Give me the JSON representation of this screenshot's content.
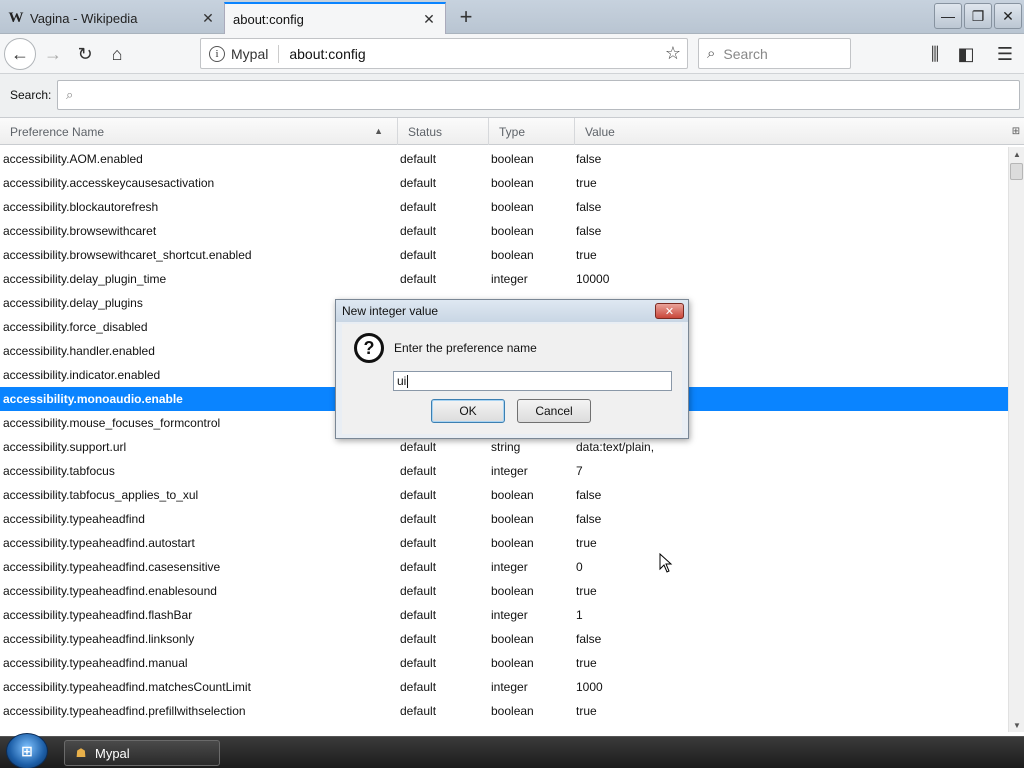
{
  "tabs": [
    {
      "favicon": "W",
      "title": "Vagina - Wikipedia",
      "close": "✕"
    },
    {
      "title": "about:config",
      "close": "✕"
    }
  ],
  "newtab_symbol": "+",
  "window_controls": {
    "minimize": "—",
    "restore": "❐",
    "close": "✕"
  },
  "navbar": {
    "back_symbol": "←",
    "forward_symbol": "→",
    "reload_symbol": "↻",
    "home_symbol": "⌂",
    "identity_label": "Mypal",
    "url": "about:config",
    "bookmark_symbol": "☆",
    "search_placeholder": "Search",
    "library_symbol": "⫼",
    "sidebar_symbol": "◧",
    "menu_symbol": "☰"
  },
  "config_search": {
    "label": "Search:",
    "placeholder": "⌕"
  },
  "columns": {
    "name": "Preference Name",
    "status": "Status",
    "type": "Type",
    "value": "Value",
    "sort_symbol": "▲",
    "picker_symbol": "⊞"
  },
  "rows": [
    {
      "name": "accessibility.AOM.enabled",
      "status": "default",
      "type": "boolean",
      "value": "false"
    },
    {
      "name": "accessibility.accesskeycausesactivation",
      "status": "default",
      "type": "boolean",
      "value": "true"
    },
    {
      "name": "accessibility.blockautorefresh",
      "status": "default",
      "type": "boolean",
      "value": "false"
    },
    {
      "name": "accessibility.browsewithcaret",
      "status": "default",
      "type": "boolean",
      "value": "false"
    },
    {
      "name": "accessibility.browsewithcaret_shortcut.enabled",
      "status": "default",
      "type": "boolean",
      "value": "true"
    },
    {
      "name": "accessibility.delay_plugin_time",
      "status": "default",
      "type": "integer",
      "value": "10000"
    },
    {
      "name": "accessibility.delay_plugins",
      "status": "",
      "type": "",
      "value": ""
    },
    {
      "name": "accessibility.force_disabled",
      "status": "",
      "type": "",
      "value": ""
    },
    {
      "name": "accessibility.handler.enabled",
      "status": "",
      "type": "",
      "value": ""
    },
    {
      "name": "accessibility.indicator.enabled",
      "status": "",
      "type": "",
      "value": ""
    },
    {
      "name": "accessibility.monoaudio.enable",
      "status": "",
      "type": "",
      "value": ""
    },
    {
      "name": "accessibility.mouse_focuses_formcontrol",
      "status": "",
      "type": "",
      "value": ""
    },
    {
      "name": "accessibility.support.url",
      "status": "default",
      "type": "string",
      "value": "data:text/plain,"
    },
    {
      "name": "accessibility.tabfocus",
      "status": "default",
      "type": "integer",
      "value": "7"
    },
    {
      "name": "accessibility.tabfocus_applies_to_xul",
      "status": "default",
      "type": "boolean",
      "value": "false"
    },
    {
      "name": "accessibility.typeaheadfind",
      "status": "default",
      "type": "boolean",
      "value": "false"
    },
    {
      "name": "accessibility.typeaheadfind.autostart",
      "status": "default",
      "type": "boolean",
      "value": "true"
    },
    {
      "name": "accessibility.typeaheadfind.casesensitive",
      "status": "default",
      "type": "integer",
      "value": "0"
    },
    {
      "name": "accessibility.typeaheadfind.enablesound",
      "status": "default",
      "type": "boolean",
      "value": "true"
    },
    {
      "name": "accessibility.typeaheadfind.flashBar",
      "status": "default",
      "type": "integer",
      "value": "1"
    },
    {
      "name": "accessibility.typeaheadfind.linksonly",
      "status": "default",
      "type": "boolean",
      "value": "false"
    },
    {
      "name": "accessibility.typeaheadfind.manual",
      "status": "default",
      "type": "boolean",
      "value": "true"
    },
    {
      "name": "accessibility.typeaheadfind.matchesCountLimit",
      "status": "default",
      "type": "integer",
      "value": "1000"
    },
    {
      "name": "accessibility.typeaheadfind.prefillwithselection",
      "status": "default",
      "type": "boolean",
      "value": "true"
    }
  ],
  "selected_row_index": 10,
  "scrollbar": {
    "up_symbol": "▲",
    "down_symbol": "▼"
  },
  "dialog": {
    "title": "New integer value",
    "close_symbol": "✕",
    "icon_symbol": "?",
    "message": "Enter the preference name",
    "input_value": "ui",
    "ok_label": "OK",
    "cancel_label": "Cancel"
  },
  "taskbar": {
    "start_symbol": "⊞",
    "app_icon": "☗",
    "app_label": "Mypal"
  },
  "colors": {
    "accent": "#0a84ff",
    "selected_text": "#ffffff",
    "dialog_close": "#c9463a"
  }
}
